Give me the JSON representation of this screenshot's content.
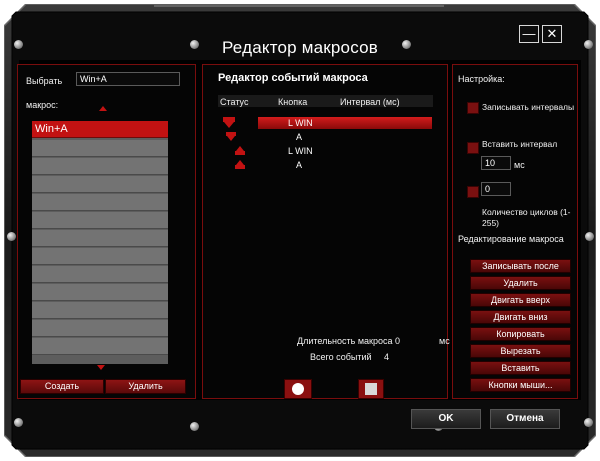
{
  "window": {
    "title": "Редактор макросов",
    "minimize_glyph": "—",
    "close_glyph": "✕"
  },
  "left_panel": {
    "select_label": "Выбрать",
    "macro_label": "макрос:",
    "macro_name_value": "Win+A",
    "list_items": [
      "Win+A"
    ],
    "create_button": "Создать",
    "delete_button": "Удалить"
  },
  "event_editor": {
    "title": "Редактор событий макроса",
    "columns": [
      "Статус",
      "Кнопка",
      "Интервал (мс)"
    ],
    "events": [
      {
        "status": "down",
        "key": "L WIN"
      },
      {
        "status": "down",
        "key": "A"
      },
      {
        "status": "up",
        "key": "L WIN"
      },
      {
        "status": "up",
        "key": "A"
      }
    ],
    "duration_label": "Длительность макроса",
    "duration_value": "0",
    "duration_unit": "мс",
    "total_events_label": "Всего событий",
    "total_events_value": "4"
  },
  "settings": {
    "title": "Настройка:",
    "record_intervals": "Записывать интервалы",
    "insert_interval": "Вставить интервал",
    "interval_value": "10",
    "interval_unit": "мс",
    "cycles_value": "0",
    "cycles_label": "Количество циклов (1-255)",
    "edit_macro_label": "Редактирование макроса",
    "edit_buttons": [
      "Записывать после",
      "Удалить",
      "Двигать вверх",
      "Двигать вниз",
      "Копировать",
      "Вырезать",
      "Вставить",
      "Кнопки мыши..."
    ]
  },
  "footer": {
    "ok_button": "OK",
    "cancel_button": "Отмена"
  },
  "colors": {
    "accent_red": "#c21212",
    "frame_red": "#7a0d0d",
    "background": "#050505"
  }
}
